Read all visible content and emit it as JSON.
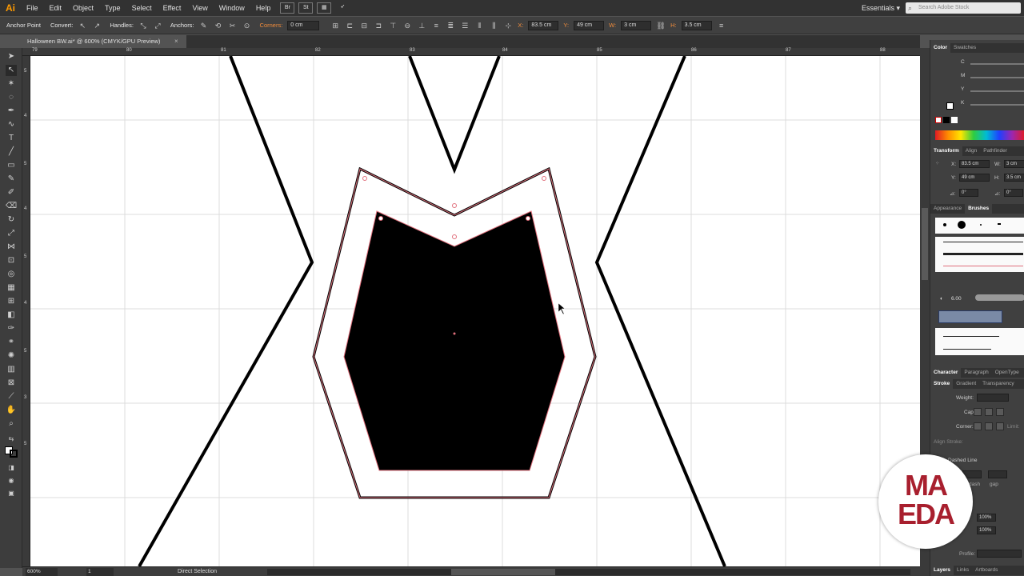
{
  "app": {
    "logo": "Ai"
  },
  "menu": [
    "File",
    "Edit",
    "Object",
    "Type",
    "Select",
    "Effect",
    "View",
    "Window",
    "Help"
  ],
  "menu_buttons": [
    "Br",
    "St"
  ],
  "workspace": "Essentials",
  "stock_search": {
    "placeholder": "Search Adobe Stock"
  },
  "control": {
    "tool_name": "Anchor Point",
    "convert_label": "Convert:",
    "handles_label": "Handles:",
    "anchors_label": "Anchors:",
    "corners_label": "Corners:",
    "corners_value": "0 cm",
    "x_label": "X:",
    "x_value": "83.5 cm",
    "y_label": "Y:",
    "y_value": "49 cm",
    "w_label": "W:",
    "w_value": "3 cm",
    "h_label": "H:",
    "h_value": "3.5 cm"
  },
  "document": {
    "tab_title": "Halloween BW.ai* @ 600% (CMYK/GPU Preview)",
    "close": "×"
  },
  "ruler": {
    "top": [
      "79",
      "80",
      "81",
      "82",
      "83",
      "84",
      "85",
      "86",
      "87",
      "88"
    ],
    "left": [
      "5",
      "4",
      "5",
      "4",
      "5",
      "4",
      "5",
      "3",
      "5"
    ]
  },
  "status": {
    "zoom": "600%",
    "page": "1",
    "text": "Direct Selection"
  },
  "panels": {
    "color_tabs": [
      "Color",
      "Swatches"
    ],
    "color_channels": [
      "C",
      "M",
      "Y",
      "K"
    ],
    "transform_tabs": [
      "Transform",
      "Align",
      "Pathfinder"
    ],
    "transform": {
      "x_label": "X:",
      "x_value": "83.5 cm",
      "w_label": "W:",
      "w_value": "3 cm",
      "y_label": "Y:",
      "y_value": "49 cm",
      "h_label": "H:",
      "h_value": "3.5 cm",
      "rot_label": "⊿:",
      "rot_value": "0°",
      "shear_label": "⊿:",
      "shear_value": "0°"
    },
    "brushes_tabs": [
      "Appearance",
      "Brushes"
    ],
    "brush_size": "6.00",
    "character_tabs": [
      "Character",
      "Paragraph",
      "OpenType"
    ],
    "stroke_tabs": [
      "Stroke",
      "Gradient",
      "Transparency"
    ],
    "stroke": {
      "weight_label": "Weight:",
      "cap_label": "Cap:",
      "corner_label": "Corner:",
      "limit_label": "Limit:",
      "align_label": "Align Stroke:",
      "dashed_label": "Dashed Line",
      "dash_label": "dash",
      "gap_label": "gap",
      "scale1": "100%",
      "scale2": "100%",
      "profile_label": "Profile:"
    },
    "bottom_tabs": [
      "Layers",
      "Links",
      "Artboards"
    ]
  },
  "logo": {
    "line1": "MA",
    "line2": "EDA"
  },
  "colors": {
    "accent": "#ff9a00",
    "selection": "#e0707c",
    "canvas": "#ffffff",
    "ui_bg": "#535353"
  }
}
